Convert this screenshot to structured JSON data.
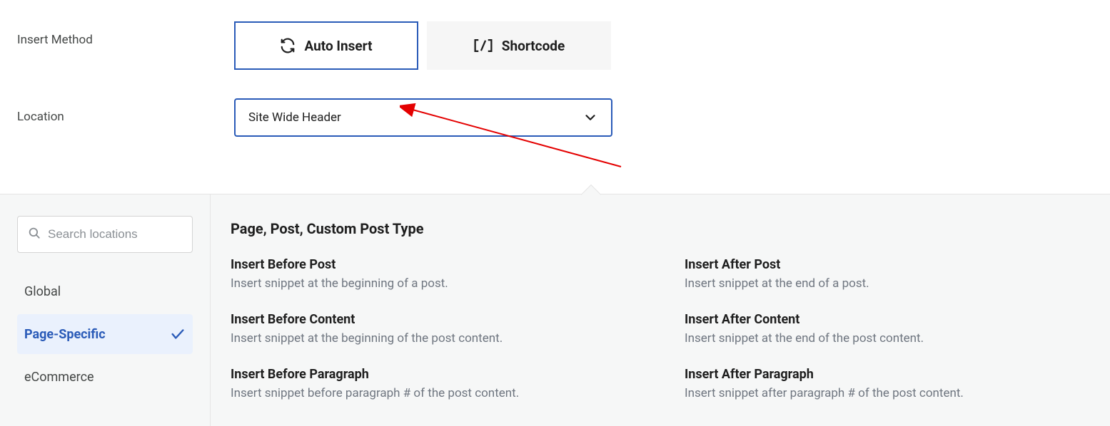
{
  "labels": {
    "insert_method": "Insert Method",
    "location": "Location"
  },
  "methods": {
    "auto_insert": "Auto Insert",
    "shortcode": "Shortcode"
  },
  "location_value": "Site Wide Header",
  "search": {
    "placeholder": "Search locations"
  },
  "categories": {
    "global": "Global",
    "page_specific": "Page-Specific",
    "ecommerce": "eCommerce"
  },
  "group_heading": "Page, Post, Custom Post Type",
  "options": {
    "before_post": {
      "title": "Insert Before Post",
      "desc": "Insert snippet at the beginning of a post."
    },
    "after_post": {
      "title": "Insert After Post",
      "desc": "Insert snippet at the end of a post."
    },
    "before_content": {
      "title": "Insert Before Content",
      "desc": "Insert snippet at the beginning of the post content."
    },
    "after_content": {
      "title": "Insert After Content",
      "desc": "Insert snippet at the end of the post content."
    },
    "before_paragraph": {
      "title": "Insert Before Paragraph",
      "desc": "Insert snippet before paragraph # of the post content."
    },
    "after_paragraph": {
      "title": "Insert After Paragraph",
      "desc": "Insert snippet after paragraph # of the post content."
    }
  }
}
